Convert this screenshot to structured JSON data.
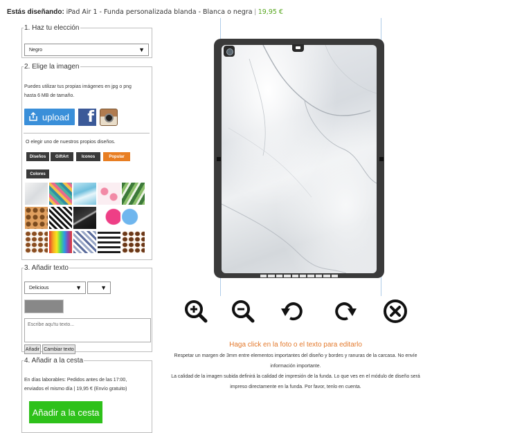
{
  "header": {
    "label": "Estás diseñando:",
    "product": "iPad Air 1 - Funda personalizada blanda - Blanca o negra",
    "separator": "|",
    "price": "19,95 €"
  },
  "step1": {
    "legend": "1. Haz tu elección",
    "select_value": "Negro"
  },
  "step2": {
    "legend": "2. Elige la imagen",
    "desc_line1": "Puedes utilizar tus propias imágenes en jpg o png",
    "desc_line2": "hasta 6 MB de tamaño.",
    "upload_label": "upload",
    "facebook_glyph": "f",
    "or_choose": "O elegir uno de nuestros propios diseños.",
    "tabs": [
      {
        "label": "Diseños"
      },
      {
        "label": "GiftArt"
      },
      {
        "label": "Iconos"
      },
      {
        "label": "Popular"
      },
      {
        "label": "Colores"
      }
    ],
    "active_tab": "Popular",
    "thumbnails": [
      "marble-white",
      "pineapples",
      "blue-marble",
      "flamingos",
      "palm-leaves",
      "animal-pattern",
      "zigzag-black",
      "black-marble",
      "pink-heart-half",
      "blue-heart-half",
      "coffee-beans",
      "paint-drips",
      "chevron-blue",
      "brush-stripes",
      "coffee-beans-2"
    ]
  },
  "step3": {
    "legend": "3. Añadir texto",
    "font_value": "Delicious",
    "size_value": "",
    "text_color": "#888888",
    "text_placeholder": "Escribe aqu'tu texto...",
    "add_button": "Añadir",
    "change_button": "Cambiar texto"
  },
  "step4": {
    "legend": "4. Añadir a la cesta",
    "info_line1": "En días laborables: Pedidos antes de las 17:00,",
    "info_line2": "enviados el mismo día | 19,95 € (Envío gratuito)",
    "cart_button": "Añadir a la cesta"
  },
  "preview": {
    "design": "white-marble",
    "tools": [
      "zoom-in",
      "zoom-out",
      "rotate-left",
      "rotate-right",
      "delete"
    ],
    "hint_click": "Haga click en la foto o el texto para editarlo",
    "note1": "Respetar un margen de 3mm entre elementos importantes del diseño y bordes y ranuras de la carcasa. No envíe",
    "note2": "información importante.",
    "note3": "La calidad de la imagen subida definirá la calidad de impresión de la funda. Lo que ves en el módulo de diseño será",
    "note4": "impreso directamente en la funda. Por favor, tenlo en cuenta."
  },
  "colors": {
    "accent_orange": "#e87e22",
    "upload_blue": "#3a8fd9",
    "cart_green": "#2ec11a",
    "price_green": "#55a51c"
  }
}
